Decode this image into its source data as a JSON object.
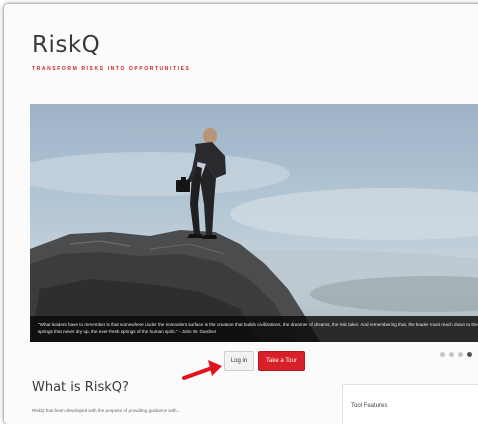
{
  "brand": {
    "name": "RiskQ",
    "tagline": "TRANSFORM RISKS INTO OPPORTUNITIES"
  },
  "hero": {
    "caption": "\"What leaders have to remember is that somewhere under the somnolent surface is the creature that builds civilizations, the dreamer of dreams, the risk taker. And remembering that, the leader must reach down to the springs that never dry up, the ever-fresh springs of the human spirit.\" - John W. Gardner"
  },
  "carousel": {
    "slide_count": 4,
    "active_index": 3
  },
  "actions": {
    "login_label": "Log in",
    "tour_label": "Take a Tour"
  },
  "about": {
    "title": "What is RiskQ?",
    "text": "RiskQ has been developed with the purpose of providing guidance with..."
  },
  "sidebar": {
    "title": "Tool Features"
  },
  "colors": {
    "accent": "#d8202a",
    "text": "#3a3a3a"
  }
}
